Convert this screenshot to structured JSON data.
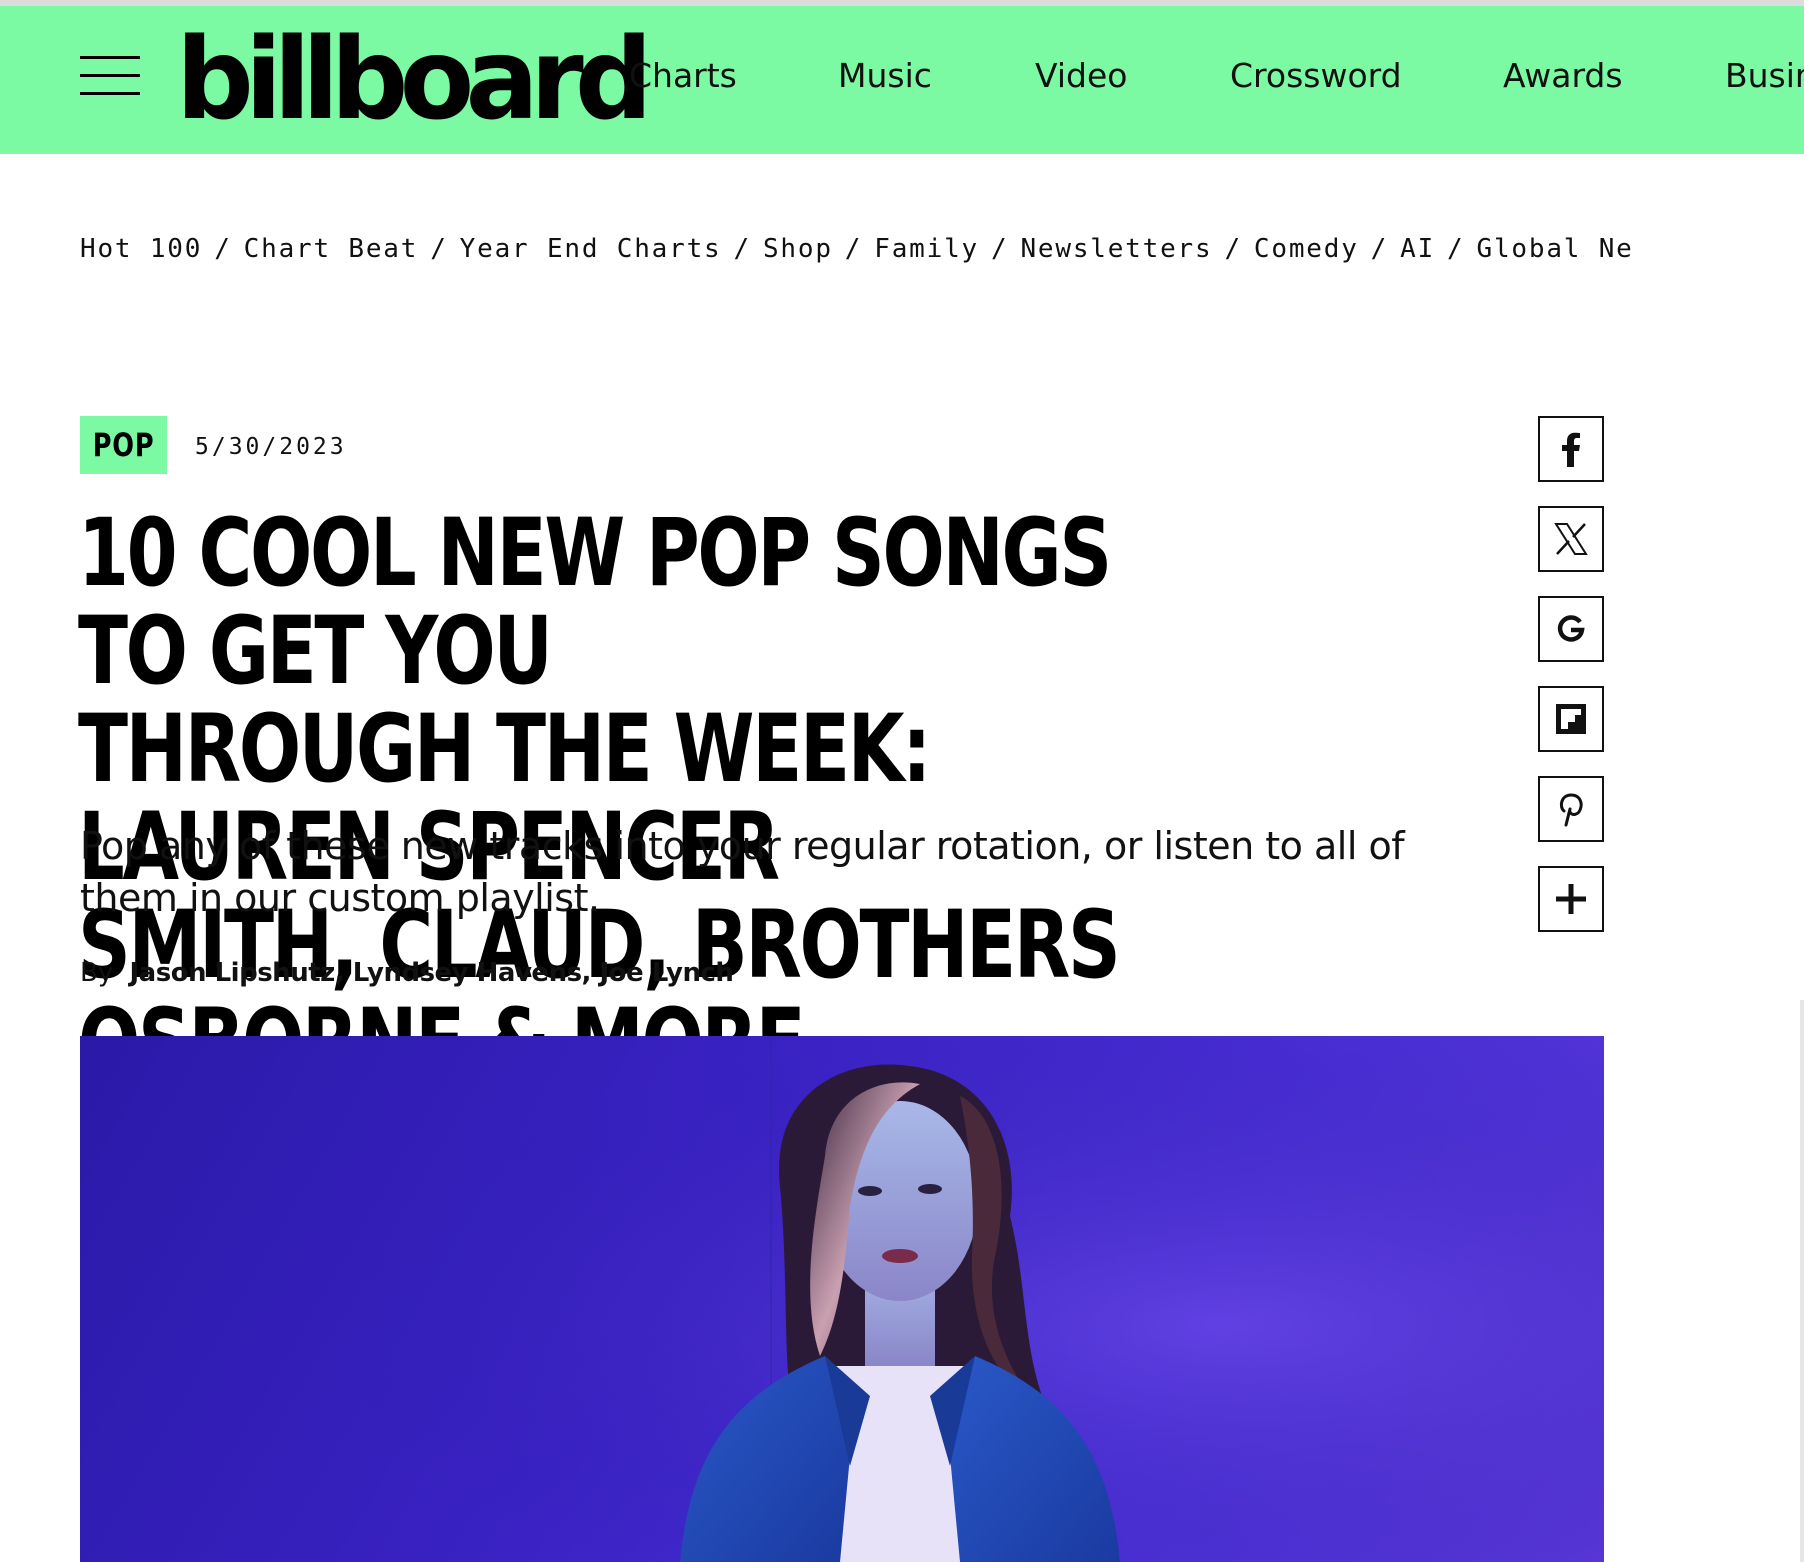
{
  "header": {
    "logo_text": "billboard",
    "nav": [
      "Charts",
      "Music",
      "Video",
      "Crossword",
      "Awards",
      "Busin"
    ],
    "accent_color": "#7bfaa3"
  },
  "subnav": {
    "items": [
      "Hot 100",
      "Chart Beat",
      "Year End Charts",
      "Shop",
      "Family",
      "Newsletters",
      "Comedy",
      "AI",
      "Global Ne"
    ],
    "separator": "/"
  },
  "article": {
    "tag": "POP",
    "date": "5/30/2023",
    "headline_lines": [
      "10 Cool New Pop Songs to Get You",
      "Through the Week: Lauren Spencer",
      "Smith, Claud, Brothers Osborne & More"
    ],
    "dek_lines": [
      "Pop any of these new tracks into your regular rotation, or listen to all of",
      "them in our custom playlist."
    ],
    "byline_prefix": "By",
    "authors": "Jason Lipshutz, Lyndsey Havens, Joe Lynch"
  },
  "share": [
    "facebook-icon",
    "x-icon",
    "google-icon",
    "flipboard-icon",
    "pinterest-icon",
    "plus-icon"
  ],
  "hero": {
    "icon": "hero-photo-woman-denim-jacket"
  }
}
